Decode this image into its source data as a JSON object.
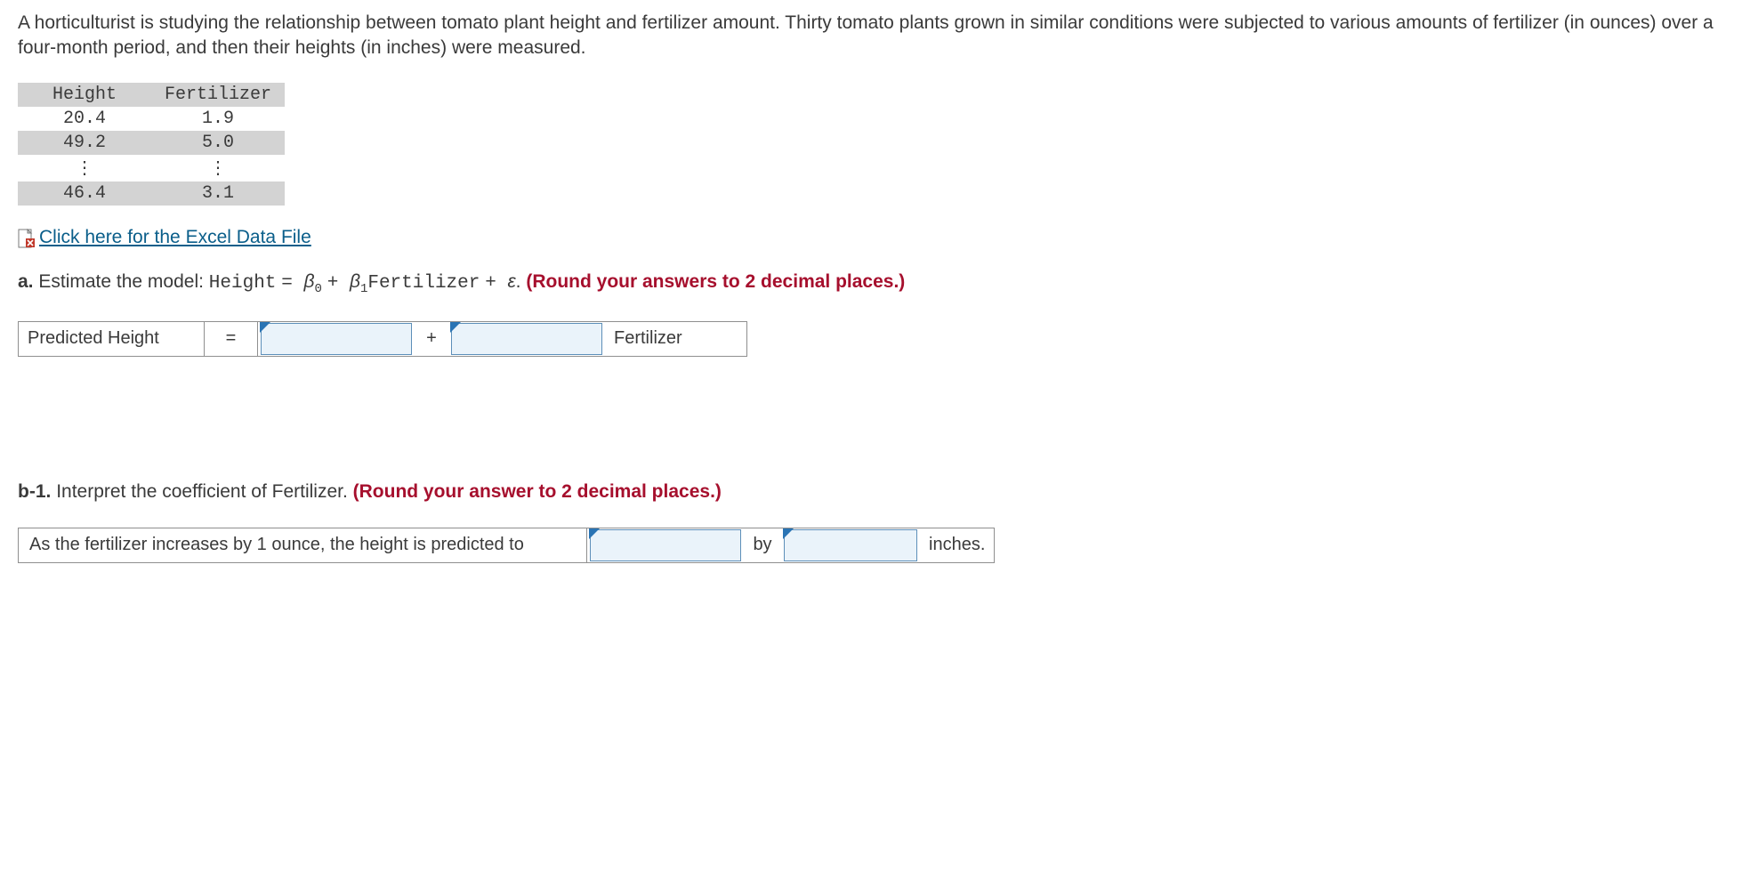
{
  "question_text": "A horticulturist is studying the relationship between tomato plant height and fertilizer amount. Thirty tomato plants grown in similar conditions were subjected to various amounts of fertilizer (in ounces) over a four-month period, and then their heights (in inches) were measured.",
  "table": {
    "headers": [
      "Height",
      "Fertilizer"
    ],
    "rows": [
      [
        "20.4",
        "1.9"
      ],
      [
        "49.2",
        "5.0"
      ],
      [
        "⋮",
        "⋮"
      ],
      [
        "46.4",
        "3.1"
      ]
    ]
  },
  "excel_link": "Click here for the Excel Data File",
  "part_a": {
    "label": "a.",
    "lead": "Estimate the model: ",
    "model_lhs": "Height",
    "model_eq": " = ",
    "beta0": "β",
    "sub0": "0",
    "plus1": " + ",
    "beta1": "β",
    "sub1": "1",
    "model_x": "Fertilizer",
    "plus2": " + ",
    "eps": "ε",
    "period": ". ",
    "round_note": "(Round your answers to 2 decimal places.)"
  },
  "answer_a": {
    "predicted_label": "Predicted Height",
    "equals": "=",
    "plus": "+",
    "var": "Fertilizer",
    "b0_value": "",
    "b1_value": ""
  },
  "part_b1": {
    "label": "b-1.",
    "lead": " Interpret the coefficient of Fertilizer. ",
    "round_note": "(Round your answer to 2 decimal places.)"
  },
  "answer_b1": {
    "sentence": "As the fertilizer increases by 1 ounce, the height is predicted to",
    "direction_value": "",
    "by": "by",
    "amount_value": "",
    "inches": "inches."
  }
}
